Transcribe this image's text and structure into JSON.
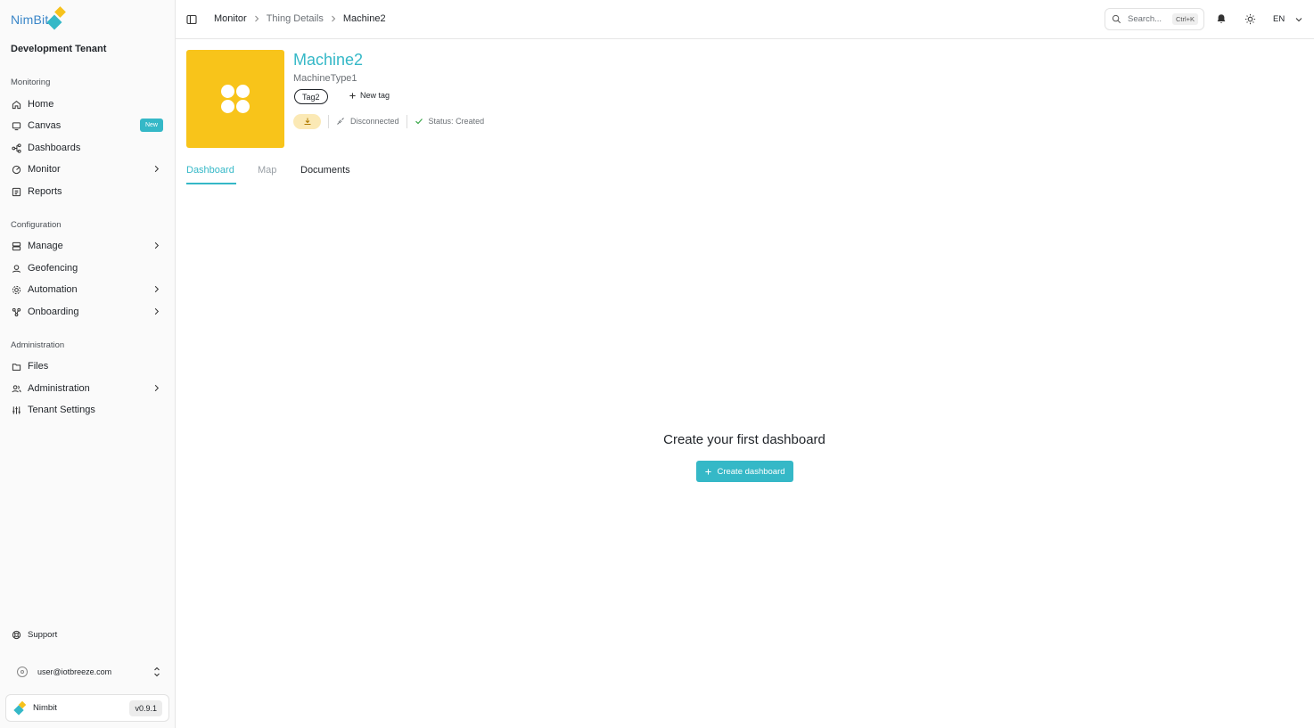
{
  "brand": {
    "logo_text": "NimBit",
    "accent": "#35b8c7",
    "accent_yellow": "#f6c21c"
  },
  "sidebar": {
    "tenant": "Development Tenant",
    "sections": [
      {
        "label": "Monitoring",
        "items": [
          {
            "label": "Home",
            "icon": "home-icon"
          },
          {
            "label": "Canvas",
            "icon": "canvas-icon",
            "badge": "New"
          },
          {
            "label": "Dashboards",
            "icon": "dashboards-icon"
          },
          {
            "label": "Monitor",
            "icon": "monitor-icon",
            "expandable": true
          },
          {
            "label": "Reports",
            "icon": "reports-icon"
          }
        ]
      },
      {
        "label": "Configuration",
        "items": [
          {
            "label": "Manage",
            "icon": "manage-icon",
            "expandable": true
          },
          {
            "label": "Geofencing",
            "icon": "geofencing-icon"
          },
          {
            "label": "Automation",
            "icon": "automation-icon",
            "expandable": true
          },
          {
            "label": "Onboarding",
            "icon": "onboarding-icon",
            "expandable": true
          }
        ]
      },
      {
        "label": "Administration",
        "items": [
          {
            "label": "Files",
            "icon": "files-icon"
          },
          {
            "label": "Administration",
            "icon": "administration-icon",
            "expandable": true
          },
          {
            "label": "Tenant Settings",
            "icon": "settings-sliders-icon"
          }
        ]
      }
    ],
    "support_label": "Support",
    "user_email": "user@iotbreeze.com",
    "app_name": "Nimbit",
    "version": "v0.9.1"
  },
  "topbar": {
    "breadcrumbs": [
      "Monitor",
      "Thing Details",
      "Machine2"
    ],
    "search_placeholder": "Search...",
    "search_shortcut": "Ctrl+K",
    "language": "EN"
  },
  "thing": {
    "name": "Machine2",
    "type": "MachineType1",
    "tags": [
      "Tag2"
    ],
    "new_tag_label": "New tag",
    "connection": "Disconnected",
    "status": "Status: Created"
  },
  "tabs": [
    {
      "label": "Dashboard",
      "state": "active"
    },
    {
      "label": "Map",
      "state": "disabled"
    },
    {
      "label": "Documents",
      "state": "normal"
    }
  ],
  "empty_state": {
    "title": "Create your first dashboard",
    "button_label": "Create dashboard"
  }
}
